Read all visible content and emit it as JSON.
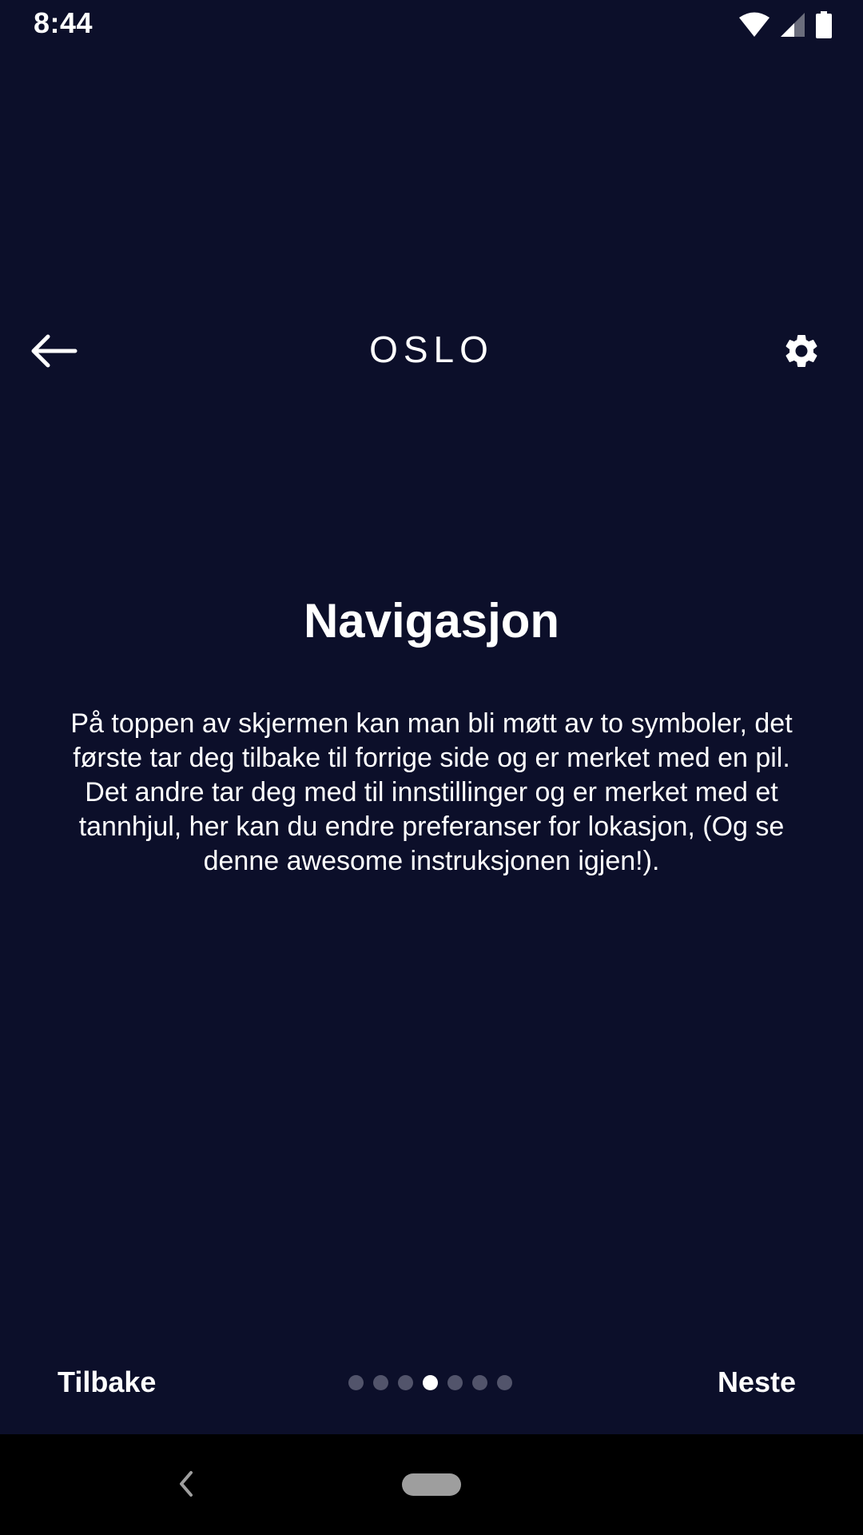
{
  "status_bar": {
    "time": "8:44",
    "icons": [
      "wifi-icon",
      "cell-signal-icon",
      "battery-icon"
    ]
  },
  "header": {
    "title": "OSLO",
    "back_icon": "arrow-left-icon",
    "settings_icon": "gear-icon"
  },
  "content": {
    "heading": "Navigasjon",
    "body": "På toppen av skjermen kan man bli møtt av to symboler, det første tar deg tilbake til forrige side og er merket med en pil. Det andre tar deg med til innstillinger og er merket med et tannhjul, her kan du endre preferanser for lokasjon, (Og se denne awesome instruksjonen igjen!)."
  },
  "pager": {
    "prev_label": "Tilbake",
    "next_label": "Neste",
    "total_pages": 7,
    "current_page": 4
  },
  "system_nav": {
    "back_icon": "chevron-left-icon",
    "home_icon": "home-pill-icon"
  },
  "colors": {
    "background": "#0c0f2a",
    "text": "#ffffff",
    "dot_inactive": "#52546b",
    "dot_active": "#ffffff",
    "system_nav_bg": "#000000"
  }
}
